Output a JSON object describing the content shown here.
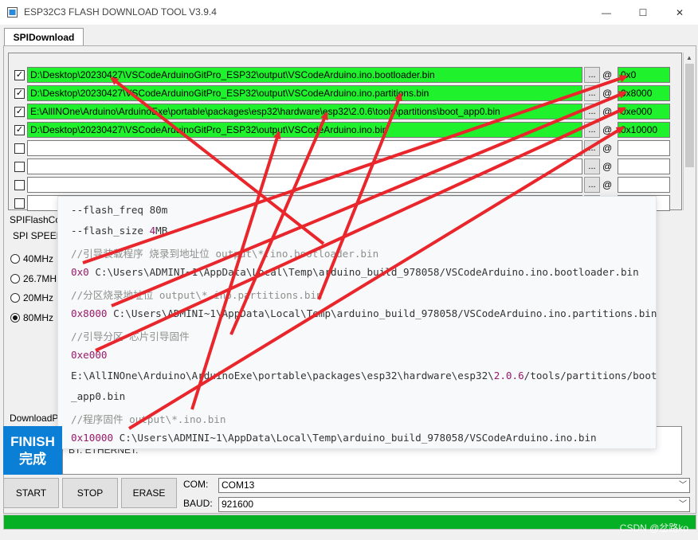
{
  "window": {
    "title": "ESP32C3 FLASH DOWNLOAD TOOL V3.9.4",
    "minimize": "—",
    "maximize": "☐",
    "close": "✕"
  },
  "tab": {
    "label": "SPIDownload"
  },
  "rows": [
    {
      "checked": true,
      "path": "D:\\Desktop\\20230427\\VSCodeArduinoGitPro_ESP32\\output\\VSCodeArduino.ino.bootloader.bin",
      "address": "0x0"
    },
    {
      "checked": true,
      "path": "D:\\Desktop\\20230427\\VSCodeArduinoGitPro_ESP32\\output\\VSCodeArduino.ino.partitions.bin",
      "address": "0x8000"
    },
    {
      "checked": true,
      "path": "E:\\AllINOne\\Arduino\\ArduinoExe\\portable\\packages\\esp32\\hardware\\esp32\\2.0.6\\tools\\partitions\\boot_app0.bin",
      "address": "0xe000"
    },
    {
      "checked": true,
      "path": "D:\\Desktop\\20230427\\VSCodeArduinoGitPro_ESP32\\output\\VSCodeArduino.ino.bin",
      "address": "0x10000"
    },
    {
      "checked": false,
      "path": "",
      "address": ""
    },
    {
      "checked": false,
      "path": "",
      "address": ""
    },
    {
      "checked": false,
      "path": "",
      "address": ""
    },
    {
      "checked": false,
      "path": "",
      "address": ""
    }
  ],
  "browse_label": "...",
  "at_sign": "@",
  "check_mark": "✓",
  "spiflash": {
    "group_label": "SPIFlashCo",
    "speed_label": "SPI SPEED",
    "options": [
      "40MHz",
      "26.7MH",
      "20MHz",
      "80MHz"
    ],
    "selected": "80MHz"
  },
  "download_label": "DownloadP",
  "popup_lines": [
    {
      "kind": "code",
      "parts": [
        {
          "t": "--flash_freq ",
          "c": "tx"
        },
        {
          "t": "80m",
          "c": "tx"
        }
      ]
    },
    {
      "kind": "code",
      "parts": [
        {
          "t": "--flash_size ",
          "c": "tx"
        },
        {
          "t": "4",
          "c": "num"
        },
        {
          "t": "MB",
          "c": "tx"
        }
      ]
    },
    {
      "kind": "comment",
      "parts": [
        {
          "t": "//引导装载程序 烧录到地址位  output\\*.ino.bootloader.bin",
          "c": "cm"
        }
      ]
    },
    {
      "kind": "code",
      "parts": [
        {
          "t": "0x0",
          "c": "num"
        },
        {
          "t": " C:\\Users\\ADMINI~1\\AppData\\Local\\Temp\\arduino_build_978058/VSCodeArduino.ino.bootloader.bin",
          "c": "tx"
        }
      ]
    },
    {
      "kind": "comment",
      "parts": [
        {
          "t": "//分区烧录地址位 output\\*.ino.partitions.bin",
          "c": "cm"
        }
      ]
    },
    {
      "kind": "code",
      "parts": [
        {
          "t": "0x8000",
          "c": "num"
        },
        {
          "t": " C:\\Users\\ADMINI~1\\AppData\\Local\\Temp\\arduino_build_978058/VSCodeArduino.ino.partitions.bin",
          "c": "tx"
        }
      ]
    },
    {
      "kind": "comment",
      "parts": [
        {
          "t": " //引导分区 芯片引导固件",
          "c": "cm"
        }
      ]
    },
    {
      "kind": "code",
      "parts": [
        {
          "t": "0xe000",
          "c": "num"
        }
      ]
    },
    {
      "kind": "code",
      "parts": [
        {
          "t": "E:\\AllINOne\\Arduino\\ArduinoExe\\portable\\packages\\esp32\\hardware\\esp32\\",
          "c": "tx"
        },
        {
          "t": "2.0.6",
          "c": "num"
        },
        {
          "t": "/tools/partitions/boot",
          "c": "tx"
        }
      ]
    },
    {
      "kind": "code",
      "parts": [
        {
          "t": "_app0.bin",
          "c": "tx"
        }
      ]
    },
    {
      "kind": "comment",
      "parts": [
        {
          "t": " //程序固件 output\\*.ino.bin",
          "c": "cm"
        }
      ]
    },
    {
      "kind": "code",
      "parts": [
        {
          "t": "0x10000",
          "c": "num"
        },
        {
          "t": " C:\\Users\\ADMINI~1\\AppData\\Local\\Temp\\arduino_build_978058/VSCodeArduino.ino.bin",
          "c": "tx"
        }
      ]
    }
  ],
  "finish": {
    "en": "FINISH",
    "zh": "完成"
  },
  "log_text": "BT:  ETHERNET:",
  "buttons": {
    "start": "START",
    "stop": "STOP",
    "erase": "ERASE"
  },
  "com": {
    "label": "COM:",
    "value": "COM13"
  },
  "baud": {
    "label": "BAUD:",
    "value": "921600"
  },
  "progress": 1.0,
  "watermark": "CSDN @岔路ko",
  "colors": {
    "filled_green": "#1ff22c",
    "finish_blue": "#0b7fd6",
    "progress_green": "#06b025",
    "arrow_red": "#e8262b"
  }
}
